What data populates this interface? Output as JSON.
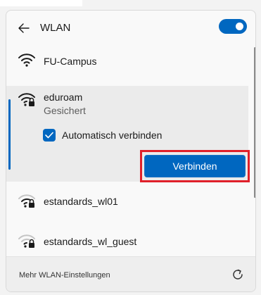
{
  "header": {
    "title": "WLAN",
    "back_icon": "arrow-left-icon",
    "wifi_enabled": true,
    "accent_color": "#0067c0"
  },
  "networks": [
    {
      "name": "FU-Campus",
      "secured": false,
      "icon": "wifi-icon"
    },
    {
      "name": "eduroam",
      "secured": true,
      "icon": "wifi-lock-icon",
      "expanded": true,
      "status": "Gesichert",
      "auto_connect_label": "Automatisch verbinden",
      "auto_connect_checked": true,
      "connect_label": "Verbinden"
    },
    {
      "name": "estandards_wl01",
      "secured": true,
      "icon": "wifi-lock-icon"
    },
    {
      "name": "estandards_wl_guest",
      "secured": true,
      "icon": "wifi-lock-icon"
    }
  ],
  "footer": {
    "more_settings_label": "Mehr WLAN-Einstellungen",
    "refresh_icon": "refresh-icon"
  },
  "highlight_color": "#e0202a"
}
